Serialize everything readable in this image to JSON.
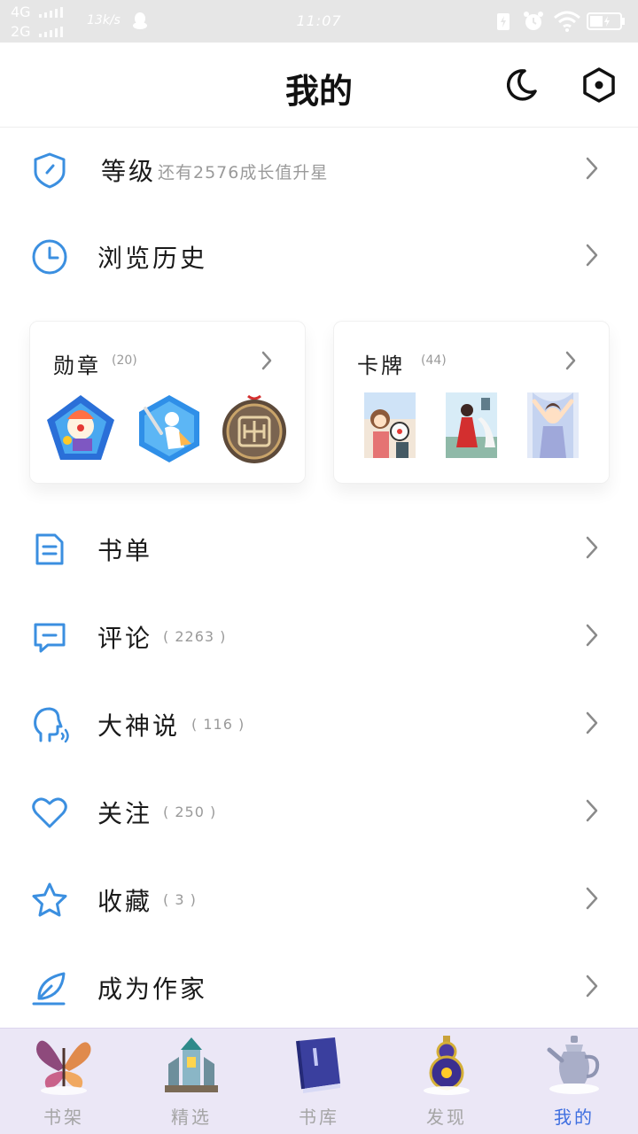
{
  "status_bar": {
    "network_1": "4G",
    "network_2": "2G",
    "speed": "13k/s",
    "time": "11:07"
  },
  "header": {
    "title": "我的",
    "night_mode_icon": "moon-icon",
    "settings_icon": "hexagon-settings-icon"
  },
  "menu_top": [
    {
      "label": "等级",
      "extra": "还有2576成长值升星",
      "icon": "shield-icon"
    },
    {
      "label": "浏览历史",
      "extra": "",
      "icon": "clock-icon"
    }
  ],
  "badges_card": {
    "title": "勋章",
    "count": "(20)"
  },
  "cards_card": {
    "title": "卡牌",
    "count": "(44)"
  },
  "menu": [
    {
      "label": "书单",
      "count": "",
      "icon": "booklist-icon"
    },
    {
      "label": "评论",
      "count": "( 2263 )",
      "icon": "comment-icon"
    },
    {
      "label": "大神说",
      "count": "( 116 )",
      "icon": "speaking-head-icon"
    },
    {
      "label": "关注",
      "count": "( 250 )",
      "icon": "heart-icon"
    },
    {
      "label": "收藏",
      "count": "( 3 )",
      "icon": "star-icon"
    },
    {
      "label": "成为作家",
      "count": "",
      "icon": "feather-icon"
    }
  ],
  "tabs": [
    {
      "label": "书架",
      "icon": "butterfly-icon"
    },
    {
      "label": "精选",
      "icon": "tower-icon"
    },
    {
      "label": "书库",
      "icon": "book-icon"
    },
    {
      "label": "发现",
      "icon": "gourd-icon"
    },
    {
      "label": "我的",
      "icon": "teapot-icon",
      "active": true
    }
  ],
  "colors": {
    "accent": "#3b8fe0",
    "tab_active": "#3f6fe0",
    "tab_bar_bg": "#ebe7f6",
    "muted_text": "#9a9a9a"
  }
}
